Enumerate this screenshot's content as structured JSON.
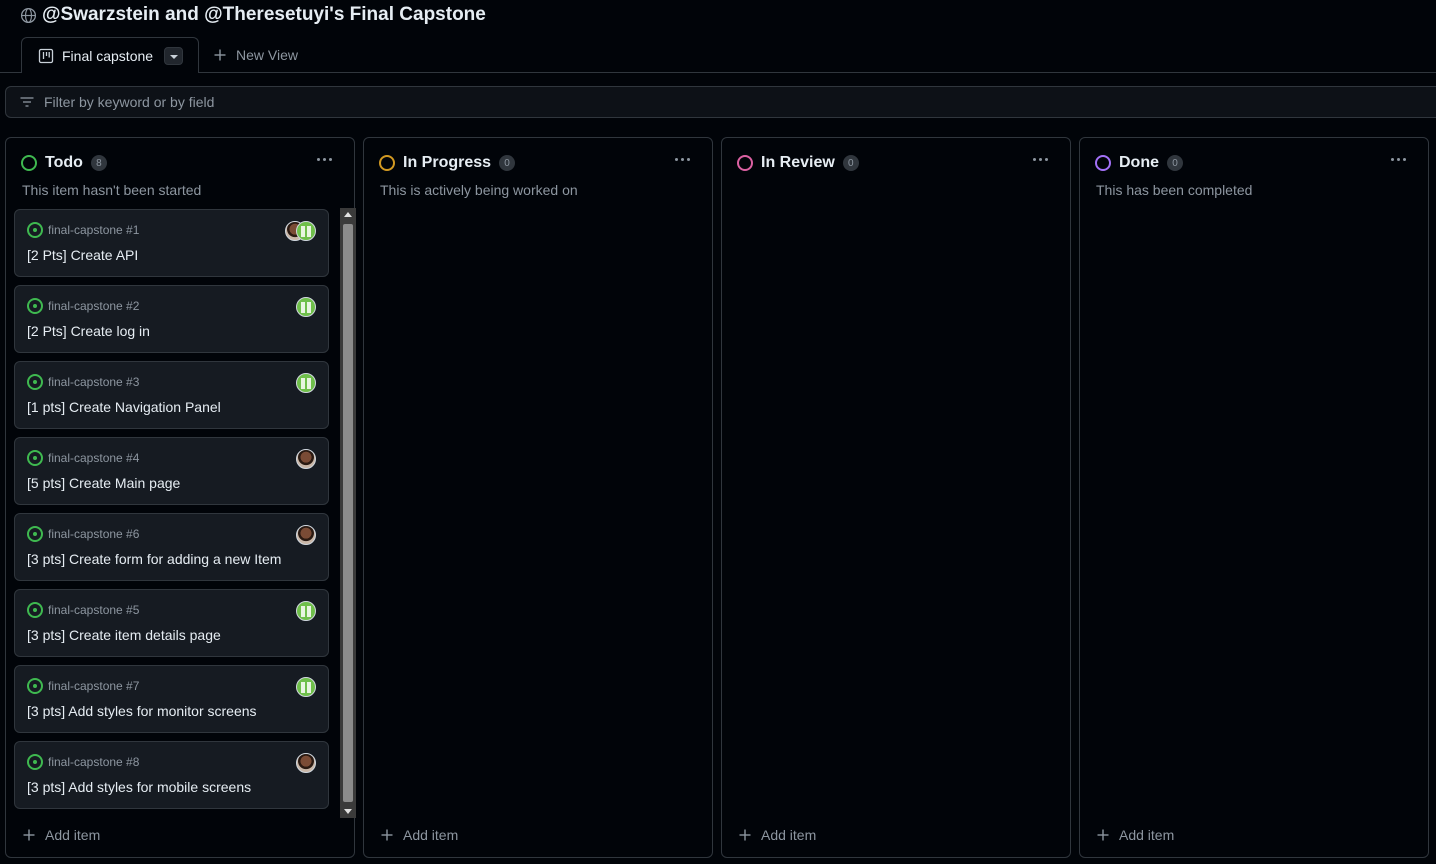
{
  "project": {
    "title": "@Swarzstein and @Theresetuyi's Final Capstone",
    "icon": "globe-icon"
  },
  "tabs": {
    "active_label": "Final capstone",
    "new_view_label": "New View"
  },
  "filter": {
    "placeholder": "Filter by keyword or by field"
  },
  "colors": {
    "todo": "#3fb950",
    "in_progress": "#d29922",
    "in_review": "#db61a2",
    "done": "#a371f7"
  },
  "columns": [
    {
      "name": "Todo",
      "count": "8",
      "description": "This item hasn't been started",
      "add_label": "Add item",
      "cards": [
        {
          "ref": "final-capstone #1",
          "title": "[2 Pts] Create API",
          "avatars": [
            "photo",
            "green"
          ]
        },
        {
          "ref": "final-capstone #2",
          "title": "[2 Pts] Create log in",
          "avatars": [
            "green"
          ]
        },
        {
          "ref": "final-capstone #3",
          "title": "[1 pts] Create Navigation Panel",
          "avatars": [
            "green"
          ]
        },
        {
          "ref": "final-capstone #4",
          "title": "[5 pts] Create Main page",
          "avatars": [
            "photo"
          ]
        },
        {
          "ref": "final-capstone #6",
          "title": "[3 pts] Create form for adding a new Item",
          "avatars": [
            "photo"
          ]
        },
        {
          "ref": "final-capstone #5",
          "title": "[3 pts] Create item details page",
          "avatars": [
            "green"
          ]
        },
        {
          "ref": "final-capstone #7",
          "title": "[3 pts] Add styles for monitor screens",
          "avatars": [
            "green"
          ]
        },
        {
          "ref": "final-capstone #8",
          "title": "[3 pts] Add styles for mobile screens",
          "avatars": [
            "photo"
          ]
        }
      ]
    },
    {
      "name": "In Progress",
      "count": "0",
      "description": "This is actively being worked on",
      "add_label": "Add item",
      "cards": []
    },
    {
      "name": "In Review",
      "count": "0",
      "description": "",
      "add_label": "Add item",
      "cards": []
    },
    {
      "name": "Done",
      "count": "0",
      "description": "This has been completed",
      "add_label": "Add item",
      "cards": []
    }
  ]
}
